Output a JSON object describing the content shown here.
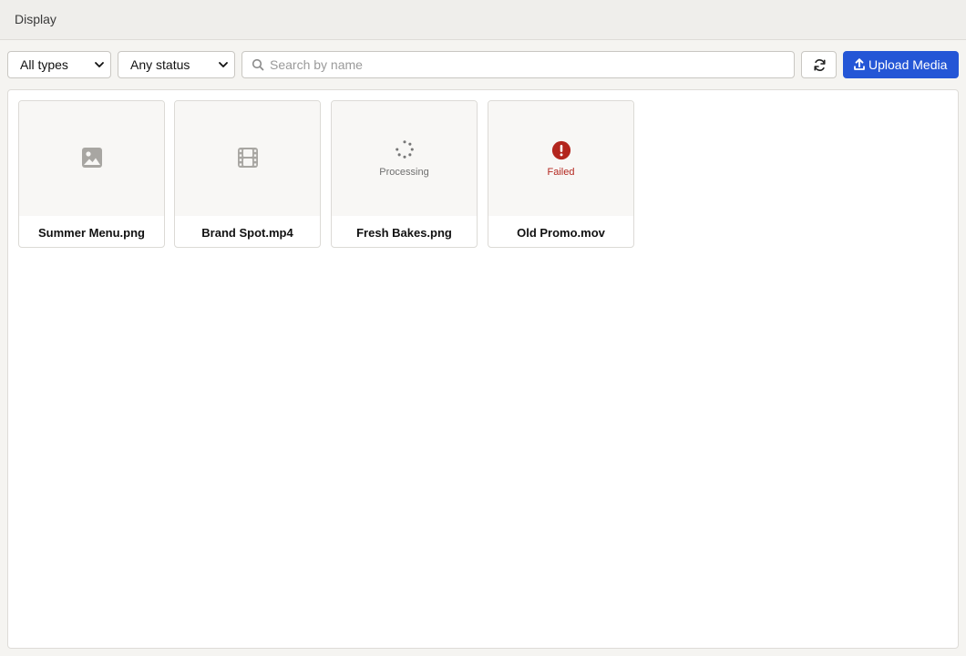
{
  "header": {
    "title": "Display"
  },
  "filters": {
    "type_selected": "All types",
    "status_selected": "Any status",
    "search_placeholder": "Search by name",
    "search_value": ""
  },
  "toolbar": {
    "refresh_icon": "refresh-icon",
    "upload_label": "Upload Media",
    "upload_icon": "upload-icon"
  },
  "colors": {
    "accent": "#2456d6",
    "error": "#b3261e",
    "icon_muted": "#a8a6a2"
  },
  "media": [
    {
      "name": "Summer Menu.png",
      "kind": "image",
      "icon": "image-icon",
      "status": ""
    },
    {
      "name": "Brand Spot.mp4",
      "kind": "video",
      "icon": "film-icon",
      "status": ""
    },
    {
      "name": "Fresh Bakes.png",
      "kind": "image",
      "icon": "spinner-icon",
      "status": "Processing"
    },
    {
      "name": "Old Promo.mov",
      "kind": "video",
      "icon": "error-icon",
      "status": "Failed"
    }
  ]
}
